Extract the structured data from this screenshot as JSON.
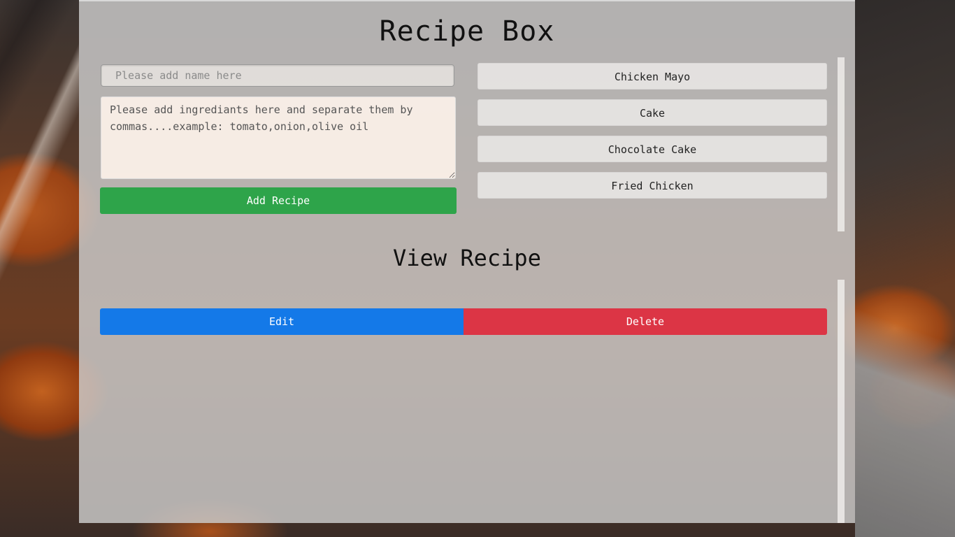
{
  "app": {
    "title": "Recipe Box"
  },
  "form": {
    "name_placeholder": "Please add name here",
    "name_value": "",
    "ingredients_placeholder": "Please add ingrediants here and separate them by commas....example: tomato,onion,olive oil",
    "ingredients_value": "",
    "add_label": "Add Recipe"
  },
  "recipes": {
    "items": [
      {
        "label": "Chicken Mayo"
      },
      {
        "label": "Cake"
      },
      {
        "label": "Chocolate Cake"
      },
      {
        "label": "Fried Chicken"
      }
    ]
  },
  "view": {
    "title": "View Recipe",
    "edit_label": "Edit",
    "delete_label": "Delete"
  },
  "colors": {
    "add_button": "#2ea44a",
    "edit_button": "#1479e8",
    "delete_button": "#dc3545"
  }
}
